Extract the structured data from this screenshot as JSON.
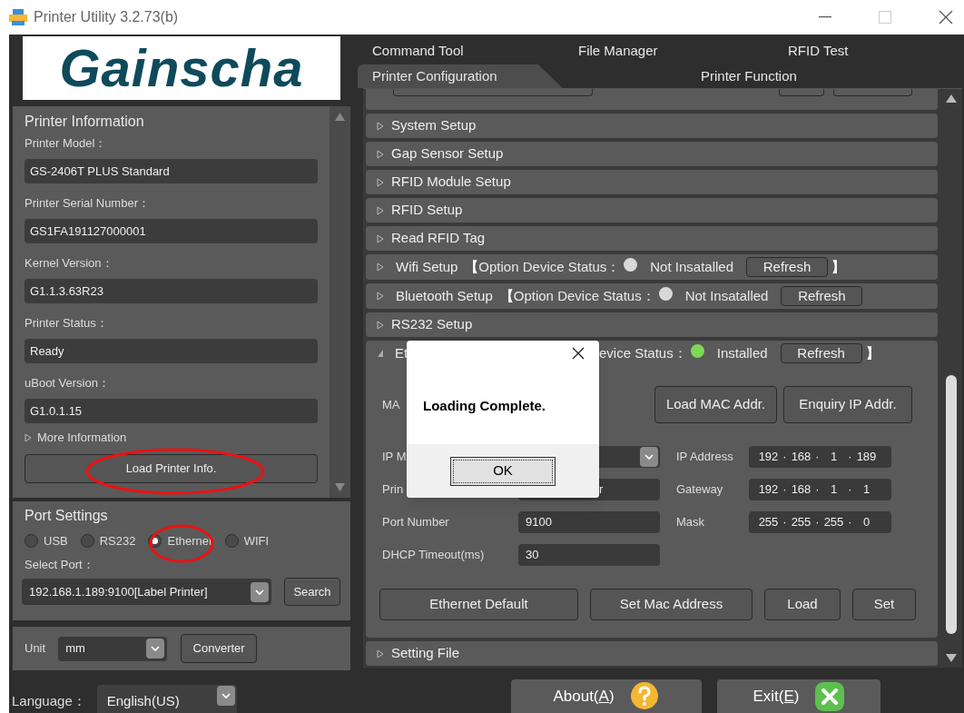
{
  "window": {
    "title": "Printer Utility 3.2.73(b)"
  },
  "logo": {
    "text": "Gainscha"
  },
  "printer_information": {
    "title": "Printer Information",
    "fields": [
      {
        "label": "Printer Model：",
        "value": "GS-2406T PLUS Standard"
      },
      {
        "label": "Printer Serial Number：",
        "value": "GS1FA191127000001"
      },
      {
        "label": "Kernel Version：",
        "value": "G1.1.3.63R23"
      },
      {
        "label": "Printer Status：",
        "value": "Ready"
      },
      {
        "label": "uBoot Version：",
        "value": "G1.0.1.15"
      }
    ],
    "more": {
      "label": "More Information",
      "expanded": false
    },
    "load_button": "Load Printer Info."
  },
  "port_settings": {
    "title": "Port Settings",
    "ports": [
      {
        "label": "USB",
        "selected": false
      },
      {
        "label": "RS232",
        "selected": false
      },
      {
        "label": "Ethernet",
        "selected": true
      },
      {
        "label": "WIFI",
        "selected": false
      }
    ],
    "select_port_label": "Select Port：",
    "port_value": "192.168.1.189:9100[Label Printer]",
    "search_button": "Search"
  },
  "unit": {
    "label": "Unit",
    "value": "mm",
    "converter_button": "Converter"
  },
  "language": {
    "label": "Language：",
    "value": "English(US)"
  },
  "tabs_row1": [
    {
      "label": "Command Tool",
      "selected": false
    },
    {
      "label": "File Manager",
      "selected": false
    },
    {
      "label": "RFID Test",
      "selected": false
    }
  ],
  "tabs_row2": [
    {
      "label": "Printer Configuration",
      "selected": true
    },
    {
      "label": "Printer Function",
      "selected": false
    }
  ],
  "sections": [
    {
      "kind": "cut"
    },
    {
      "kind": "plain",
      "title": "System Setup",
      "expanded": false
    },
    {
      "kind": "plain",
      "title": "Gap Sensor Setup",
      "expanded": false
    },
    {
      "kind": "plain",
      "title": "RFID Module Setup",
      "expanded": false
    },
    {
      "kind": "plain",
      "title": "RFID Setup",
      "expanded": false
    },
    {
      "kind": "plain",
      "title": "Read RFID Tag",
      "expanded": false
    },
    {
      "kind": "option",
      "title": "Wifi Setup",
      "expanded": false,
      "bracket_open": "【",
      "status_label": "Option Device Status：",
      "color": "#d9d9d9",
      "status": "Not Insatalled",
      "refresh": "Refresh",
      "bracket_close": "】"
    },
    {
      "kind": "option",
      "title": "Bluetooth Setup",
      "expanded": false,
      "bracket_open": "【",
      "status_label": "Option Device Status：",
      "color": "#d9d9d9",
      "status": "Not Insatalled",
      "refresh": "Refresh"
    },
    {
      "kind": "plain",
      "title": "RS232 Setup",
      "expanded": false
    },
    {
      "kind": "ethernet",
      "title": "Et",
      "expanded": true,
      "status_label": "evice Status：",
      "color": "#7ed957",
      "status": "Installed",
      "refresh": "Refresh",
      "bracket_close": "】",
      "mac_label": "MA",
      "top_buttons": [
        "Load MAC Addr.",
        "Enquiry IP Addr."
      ],
      "left_rows": [
        {
          "label": "IP M",
          "kind": "select"
        },
        {
          "label": "Prin",
          "kind": "text",
          "value": "r"
        },
        {
          "label": "Port Number",
          "kind": "text",
          "value": "9100"
        },
        {
          "label": "DHCP Timeout(ms)",
          "kind": "text",
          "value": "30"
        }
      ],
      "right_rows": [
        {
          "label": "IP Address",
          "octets": [
            "192",
            "168",
            "1",
            "189"
          ]
        },
        {
          "label": "Gateway",
          "octets": [
            "192",
            "168",
            "1",
            "1"
          ]
        },
        {
          "label": "Mask",
          "octets": [
            "255",
            "255",
            "255",
            "0"
          ]
        }
      ],
      "separator": "·",
      "bottom_buttons": [
        "Ethernet Default",
        "Set Mac Address",
        "Load",
        "Set"
      ]
    },
    {
      "kind": "plain",
      "title": "Setting File",
      "expanded": false
    }
  ],
  "dialog": {
    "message": "Loading Complete.",
    "ok": "OK"
  },
  "footer_buttons": [
    {
      "kind": "about",
      "before": "About(",
      "key": "A",
      "after": ")"
    },
    {
      "kind": "exit",
      "before": "Exit(",
      "key": "E",
      "after": ")"
    }
  ]
}
